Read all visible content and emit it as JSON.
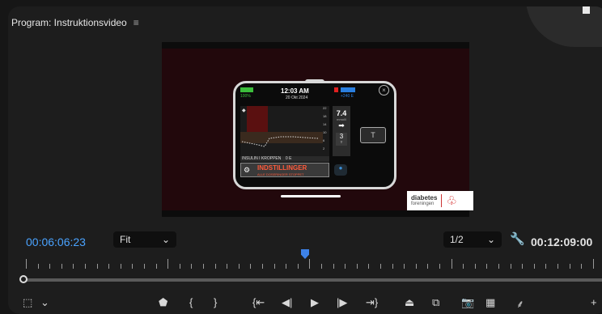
{
  "panel": {
    "title": "Program: Instruktionsvideo",
    "menu_icon": "hamburger-icon"
  },
  "device": {
    "battery_pct": "100%",
    "time": "12:03 AM",
    "date": "20 Okt 2024",
    "insulin_units": "+240 E",
    "axis_ticks": [
      "22",
      "18",
      "14",
      "10",
      "6",
      "2"
    ],
    "bg_value": "7.4",
    "bg_unit": "mmol/l",
    "trend_arrow": "➡",
    "iob_value": "3",
    "iob_unit": "T",
    "insulin_label": "INSULIN I KROPPEN",
    "insulin_value": "0 E",
    "settings_title": "INDSTILLINGER",
    "settings_sub": "ALLE DOSERINGER STOPPET",
    "tbutton": "T"
  },
  "logo": {
    "line1": "diabetes",
    "line2": "foreningen"
  },
  "timecodes": {
    "current": "00:06:06:23",
    "duration": "00:12:09:00"
  },
  "fit_select": {
    "value": "Fit"
  },
  "resolution_select": {
    "value": "1/2"
  },
  "colors": {
    "accent": "#3d82e8",
    "timecode_current": "#4aa3ff",
    "background": "#1d1d1d"
  },
  "transport_icons": [
    "add-marker-icon",
    "mark-in-icon",
    "mark-out-icon",
    "go-to-in-icon",
    "step-back-icon",
    "play-icon",
    "step-forward-icon",
    "go-to-out-icon",
    "lift-icon",
    "extract-icon",
    "export-frame-icon",
    "comparison-view-icon",
    "vr-video-icon",
    "button-editor-icon"
  ]
}
